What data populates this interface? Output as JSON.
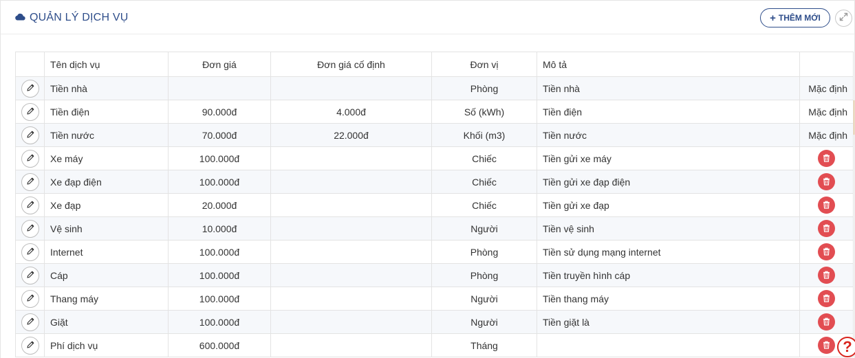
{
  "header": {
    "title": "QUẢN LÝ DỊCH VỤ",
    "title_icon": "cloud-icon",
    "add_button_label": "THÊM MỚI",
    "expand_icon": "expand-icon"
  },
  "table": {
    "columns": [
      "",
      "Tên dịch vụ",
      "Đơn giá",
      "Đơn giá cố định",
      "Đơn vị",
      "Mô tả",
      ""
    ],
    "rows": [
      {
        "name": "Tiền nhà",
        "price": "",
        "fixed_price": "",
        "unit": "Phòng",
        "description": "Tiền nhà",
        "action": "Mặc định",
        "deletable": false
      },
      {
        "name": "Tiền điện",
        "price": "90.000đ",
        "fixed_price": "4.000đ",
        "unit": "Số (kWh)",
        "description": "Tiền điện",
        "action": "Mặc định",
        "deletable": false
      },
      {
        "name": "Tiền nước",
        "price": "70.000đ",
        "fixed_price": "22.000đ",
        "unit": "Khối (m3)",
        "description": "Tiền nước",
        "action": "Mặc định",
        "deletable": false
      },
      {
        "name": "Xe máy",
        "price": "100.000đ",
        "fixed_price": "",
        "unit": "Chiếc",
        "description": "Tiền gửi xe máy",
        "action": "",
        "deletable": true
      },
      {
        "name": "Xe đạp điện",
        "price": "100.000đ",
        "fixed_price": "",
        "unit": "Chiếc",
        "description": "Tiền gửi xe đạp điện",
        "action": "",
        "deletable": true
      },
      {
        "name": "Xe đạp",
        "price": "20.000đ",
        "fixed_price": "",
        "unit": "Chiếc",
        "description": "Tiền gửi xe đạp",
        "action": "",
        "deletable": true
      },
      {
        "name": "Vệ sinh",
        "price": "10.000đ",
        "fixed_price": "",
        "unit": "Người",
        "description": "Tiền vệ sinh",
        "action": "",
        "deletable": true
      },
      {
        "name": "Internet",
        "price": "100.000đ",
        "fixed_price": "",
        "unit": "Phòng",
        "description": "Tiền sử dụng mạng internet",
        "action": "",
        "deletable": true
      },
      {
        "name": "Cáp",
        "price": "100.000đ",
        "fixed_price": "",
        "unit": "Phòng",
        "description": "Tiền truyền hình cáp",
        "action": "",
        "deletable": true
      },
      {
        "name": "Thang máy",
        "price": "100.000đ",
        "fixed_price": "",
        "unit": "Người",
        "description": "Tiền thang máy",
        "action": "",
        "deletable": true
      },
      {
        "name": "Giặt",
        "price": "100.000đ",
        "fixed_price": "",
        "unit": "Người",
        "description": "Tiền giặt là",
        "action": "",
        "deletable": true
      },
      {
        "name": "Phí dịch vụ",
        "price": "600.000đ",
        "fixed_price": "",
        "unit": "Tháng",
        "description": "",
        "action": "",
        "deletable": true
      }
    ]
  },
  "help": {
    "label": "?",
    "icon": "help-icon"
  },
  "colors": {
    "accent": "#2e4d8a",
    "delete": "#e24d52",
    "help": "#d9241d",
    "row_alt": "#f6f8fb"
  }
}
